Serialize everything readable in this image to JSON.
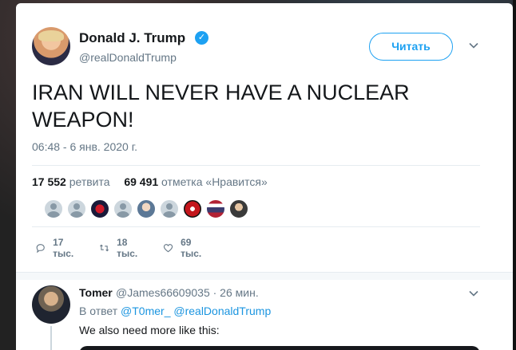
{
  "tweet": {
    "author_name": "Donald J. Trump",
    "author_handle": "@realDonaldTrump",
    "follow_label": "Читать",
    "text": "IRAN WILL NEVER HAVE A NUCLEAR WEAPON!",
    "timestamp": "06:48 - 6 янв. 2020 г.",
    "retweets_count": "17 552",
    "retweets_label": "ретвита",
    "likes_count": "69 491",
    "likes_label": "отметка «Нравится»",
    "actions": {
      "reply_count": "17 тыс.",
      "retweet_count": "18 тыс.",
      "like_count": "69 тыс."
    },
    "liker_avatars": [
      "default",
      "default",
      "custom",
      "default",
      "custom",
      "default",
      "custom",
      "custom",
      "custom"
    ]
  },
  "reply": {
    "name": "Tomer",
    "handle_time": "@James66609035 · 26 мин.",
    "in_reply_prefix": "В ответ",
    "mention1": "@T0mer_",
    "mention2": "@realDonaldTrump",
    "text": "We also need more like this:"
  },
  "colors": {
    "accent": "#1da1f2",
    "text": "#14171a",
    "muted": "#657786"
  },
  "icons": [
    "verified-icon",
    "chevron-down-icon",
    "reply-icon",
    "retweet-icon",
    "like-icon"
  ]
}
